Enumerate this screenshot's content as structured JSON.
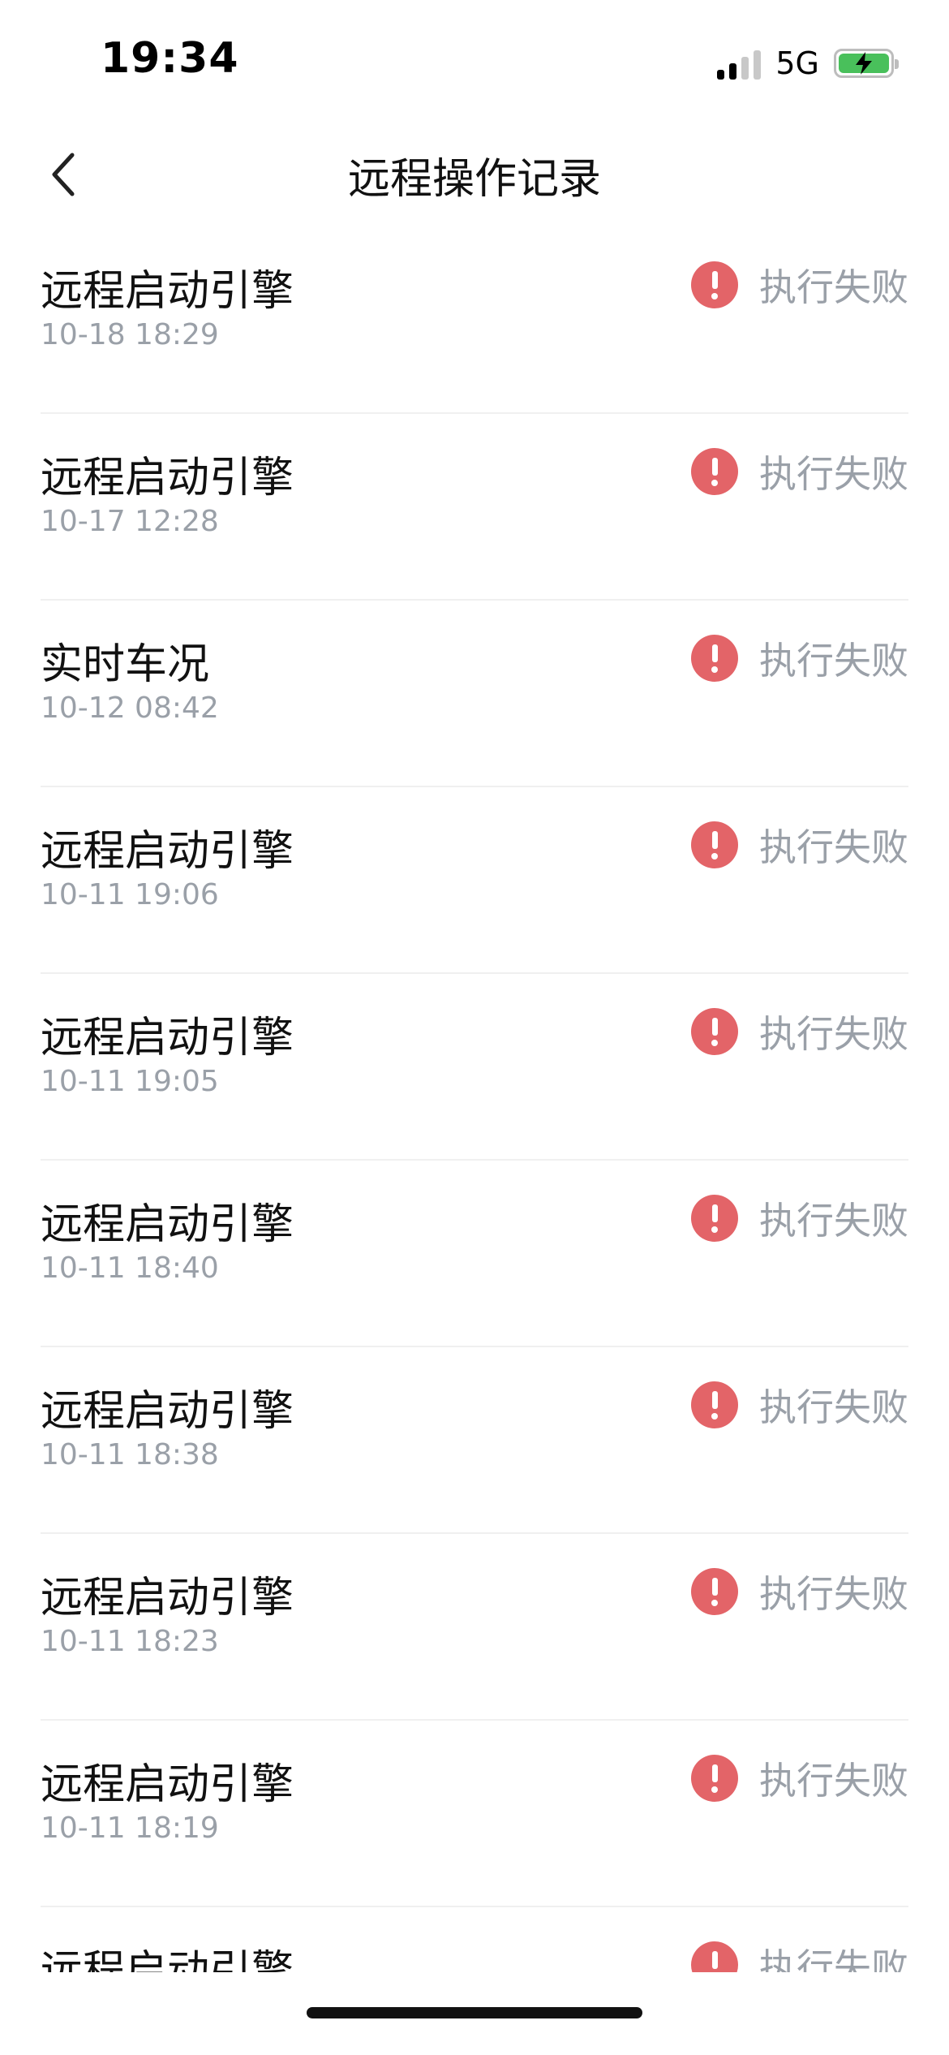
{
  "status_bar": {
    "time": "19:34",
    "network": "5G"
  },
  "header": {
    "title": "远程操作记录"
  },
  "records": [
    {
      "title": "远程启动引擎",
      "time": "10-18 18:29",
      "status": "执行失败"
    },
    {
      "title": "远程启动引擎",
      "time": "10-17 12:28",
      "status": "执行失败"
    },
    {
      "title": "实时车况",
      "time": "10-12 08:42",
      "status": "执行失败"
    },
    {
      "title": "远程启动引擎",
      "time": "10-11 19:06",
      "status": "执行失败"
    },
    {
      "title": "远程启动引擎",
      "time": "10-11 19:05",
      "status": "执行失败"
    },
    {
      "title": "远程启动引擎",
      "time": "10-11 18:40",
      "status": "执行失败"
    },
    {
      "title": "远程启动引擎",
      "time": "10-11 18:38",
      "status": "执行失败"
    },
    {
      "title": "远程启动引擎",
      "time": "10-11 18:23",
      "status": "执行失败"
    },
    {
      "title": "远程启动引擎",
      "time": "10-11 18:19",
      "status": "执行失败"
    },
    {
      "title": "远程启动引擎",
      "time": "",
      "status": "执行失败"
    }
  ],
  "colors": {
    "error": "#e36468",
    "muted_text": "#9aa0a8",
    "battery": "#49c05b"
  }
}
